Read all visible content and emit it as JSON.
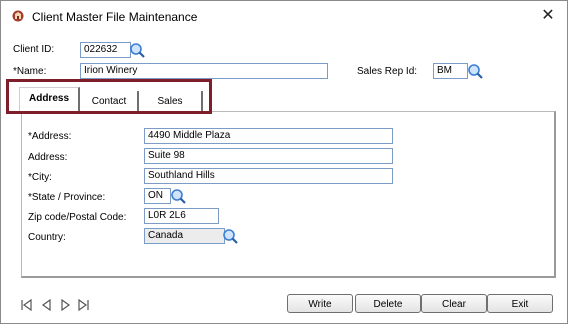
{
  "window": {
    "title": "Client Master File Maintenance",
    "close_glyph": "✕"
  },
  "header": {
    "client_id_label": "Client ID:",
    "client_id_value": "022632",
    "name_label": "*Name:",
    "name_value": "Irion Winery",
    "sales_rep_label": "Sales Rep Id:",
    "sales_rep_value": "BM"
  },
  "tabs": [
    {
      "label": "Address",
      "active": true
    },
    {
      "label": "Contact",
      "active": false
    },
    {
      "label": "Sales",
      "active": false
    }
  ],
  "address": {
    "address1_label": "*Address:",
    "address1_value": "4490 Middle Plaza",
    "address2_label": "Address:",
    "address2_value": "Suite 98",
    "city_label": "*City:",
    "city_value": "Southland Hills",
    "state_label": "*State / Province:",
    "state_value": "ON",
    "zip_label": "Zip code/Postal Code:",
    "zip_value": "L0R 2L6",
    "country_label": "Country:",
    "country_value": "Canada"
  },
  "buttons": {
    "write": "Write",
    "delete": "Delete",
    "clear": "Clear",
    "exit": "Exit"
  },
  "colors": {
    "highlight": "#7d1e2a",
    "field_border": "#7a9cc7",
    "lookup_blue": "#3b7fd4"
  },
  "icons": {
    "app": "app-icon",
    "lookup": "magnifier-icon",
    "nav": [
      "first-record-icon",
      "previous-record-icon",
      "next-record-icon",
      "last-record-icon"
    ]
  }
}
